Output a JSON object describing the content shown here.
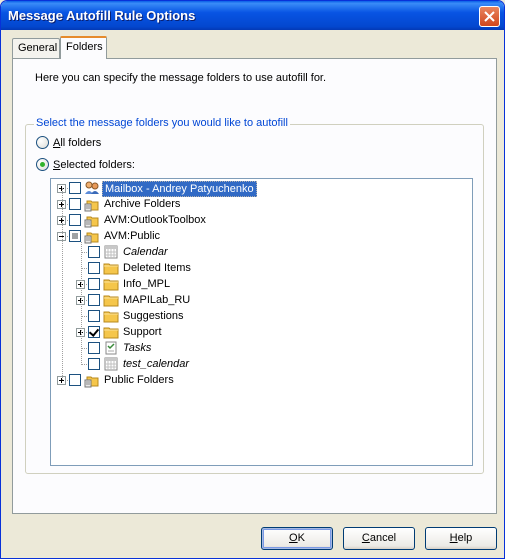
{
  "window": {
    "title": "Message Autofill Rule Options"
  },
  "tabs": [
    {
      "label": "General",
      "active": false
    },
    {
      "label": "Folders",
      "active": true
    }
  ],
  "folders_tab": {
    "intro": "Here you can specify the message folders to use autofill for.",
    "group_label": "Select the message folders you would like to autofill",
    "radio_all": {
      "accel": "A",
      "rest": "ll folders",
      "checked": false
    },
    "radio_selected": {
      "accel": "S",
      "rest": "elected folders:",
      "checked": true
    }
  },
  "tree": {
    "items": [
      {
        "label": "Mailbox - Andrey Patyuchenko",
        "level": 0,
        "expander": "plus",
        "check": "unchecked",
        "icon": "mailbox-icon",
        "italic": false,
        "selected": true
      },
      {
        "label": "Archive Folders",
        "level": 0,
        "expander": "plus",
        "check": "unchecked",
        "icon": "pst-folder-icon",
        "italic": false,
        "selected": false
      },
      {
        "label": "AVM:OutlookToolbox",
        "level": 0,
        "expander": "plus",
        "check": "unchecked",
        "icon": "pst-folder-icon",
        "italic": false,
        "selected": false
      },
      {
        "label": "AVM:Public",
        "level": 0,
        "expander": "minus",
        "check": "partial",
        "icon": "pst-folder-icon",
        "italic": false,
        "selected": false
      },
      {
        "label": "Calendar",
        "level": 1,
        "expander": "none",
        "check": "unchecked",
        "icon": "calendar-icon",
        "italic": true,
        "selected": false
      },
      {
        "label": "Deleted Items",
        "level": 1,
        "expander": "none",
        "check": "unchecked",
        "icon": "folder-icon",
        "italic": false,
        "selected": false
      },
      {
        "label": "Info_MPL",
        "level": 1,
        "expander": "plus",
        "check": "unchecked",
        "icon": "folder-icon",
        "italic": false,
        "selected": false
      },
      {
        "label": "MAPILab_RU",
        "level": 1,
        "expander": "plus",
        "check": "unchecked",
        "icon": "folder-icon",
        "italic": false,
        "selected": false
      },
      {
        "label": "Suggestions",
        "level": 1,
        "expander": "none",
        "check": "unchecked",
        "icon": "folder-icon",
        "italic": false,
        "selected": false
      },
      {
        "label": "Support",
        "level": 1,
        "expander": "plus",
        "check": "checked",
        "icon": "folder-icon",
        "italic": false,
        "selected": false
      },
      {
        "label": "Tasks",
        "level": 1,
        "expander": "none",
        "check": "unchecked",
        "icon": "tasks-icon",
        "italic": true,
        "selected": false
      },
      {
        "label": "test_calendar",
        "level": 1,
        "expander": "none",
        "check": "unchecked",
        "icon": "calendar-icon",
        "italic": true,
        "selected": false
      },
      {
        "label": "Public Folders",
        "level": 0,
        "expander": "plus",
        "check": "unchecked",
        "icon": "pst-folder-icon",
        "italic": false,
        "selected": false
      }
    ]
  },
  "buttons": {
    "ok": {
      "accel": "O",
      "rest": "K"
    },
    "cancel": {
      "accel": "C",
      "rest": "ancel"
    },
    "help": {
      "accel": "H",
      "rest": "elp"
    }
  },
  "colors": {
    "titlebar": "#0854e3",
    "dialog_bg": "#ece9d8",
    "group_label": "#0046d5",
    "selection": "#316ac5",
    "active_tab_accent": "#e68b2c",
    "folder_yellow": "#f5c64b"
  }
}
